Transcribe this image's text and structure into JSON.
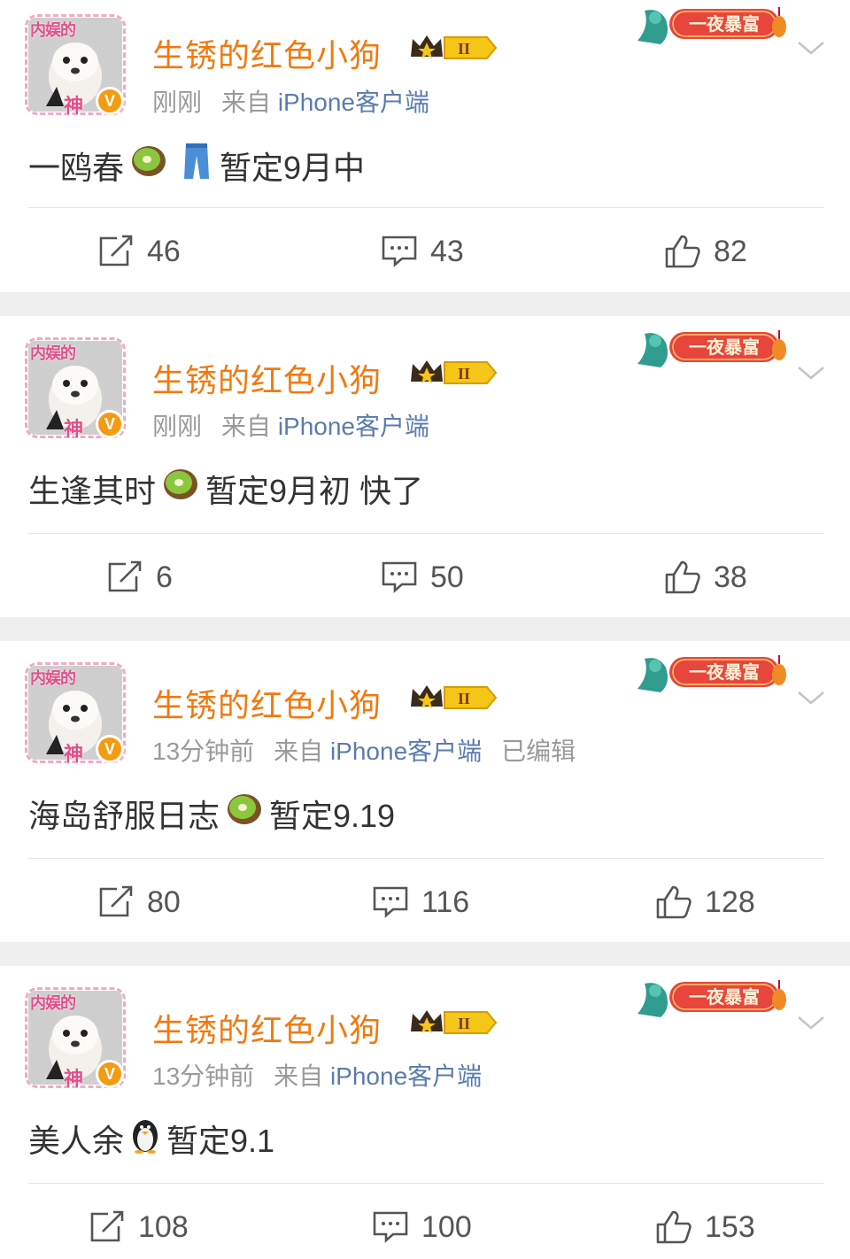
{
  "posts": [
    {
      "username": "生锈的红色小狗",
      "time": "刚刚",
      "source": "来自",
      "device": "iPhone客户端",
      "edited": "",
      "text_parts": [
        "一鸥春",
        "暂定9月中"
      ],
      "emojis": [
        "kiwi-emoji",
        "jeans-emoji"
      ],
      "reposts": "46",
      "comments": "43",
      "likes": "82"
    },
    {
      "username": "生锈的红色小狗",
      "time": "刚刚",
      "source": "来自",
      "device": "iPhone客户端",
      "edited": "",
      "text_parts": [
        "生逢其时",
        "暂定9月初 快了"
      ],
      "emojis": [
        "kiwi-emoji"
      ],
      "reposts": "6",
      "comments": "50",
      "likes": "38"
    },
    {
      "username": "生锈的红色小狗",
      "time": "13分钟前",
      "source": "来自",
      "device": "iPhone客户端",
      "edited": "已编辑",
      "text_parts": [
        "海岛舒服日志",
        "暂定9.19"
      ],
      "emojis": [
        "kiwi-emoji"
      ],
      "reposts": "80",
      "comments": "116",
      "likes": "128"
    },
    {
      "username": "生锈的红色小狗",
      "time": "13分钟前",
      "source": "来自",
      "device": "iPhone客户端",
      "edited": "",
      "text_parts": [
        "美人余",
        "暂定9.1"
      ],
      "emojis": [
        "penguin-emoji"
      ],
      "reposts": "108",
      "comments": "100",
      "likes": "153"
    }
  ],
  "avatar_frame_text": "内娱的",
  "avatar_frame_text2": "神",
  "verified_mark": "V",
  "badge_level": "II",
  "decor_text": "一夜暴富",
  "colors": {
    "username": "#f2790e",
    "source_link": "#5b7bae",
    "meta_gray": "#9a9a9a",
    "separator_bg": "#efefef",
    "icon_gray": "#555555"
  }
}
